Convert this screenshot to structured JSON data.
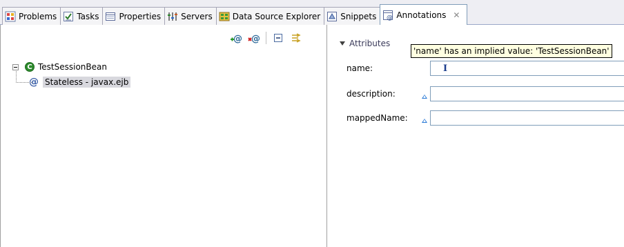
{
  "tabs": [
    {
      "label": "Problems",
      "icon": "problems-icon"
    },
    {
      "label": "Tasks",
      "icon": "tasks-icon"
    },
    {
      "label": "Properties",
      "icon": "properties-icon"
    },
    {
      "label": "Servers",
      "icon": "servers-icon"
    },
    {
      "label": "Data Source Explorer",
      "icon": "data-source-explorer-icon"
    },
    {
      "label": "Snippets",
      "icon": "snippets-icon"
    },
    {
      "label": "Annotations",
      "icon": "annotations-icon",
      "active": true
    }
  ],
  "toolbar": {
    "buttons": [
      "add-annotation-icon",
      "remove-annotation-icon",
      "collapse-all-icon",
      "link-with-editor-icon"
    ]
  },
  "tree": {
    "root_label": "TestSessionBean",
    "child_label": "Stateless - javax.ejb",
    "root_icon_glyph": "C",
    "child_icon_glyph": "@"
  },
  "attributes": {
    "section_title": "Attributes",
    "fields": [
      {
        "label": "name:",
        "value": ""
      },
      {
        "label": "description:",
        "value": ""
      },
      {
        "label": "mappedName:",
        "value": ""
      }
    ],
    "tooltip": "'name' has an implied value: 'TestSessionBean'",
    "cursor_glyph": "I"
  },
  "colors": {
    "accent": "#7f9db9",
    "selection": "#d8d8de",
    "tooltip_bg": "#ffffe1"
  }
}
